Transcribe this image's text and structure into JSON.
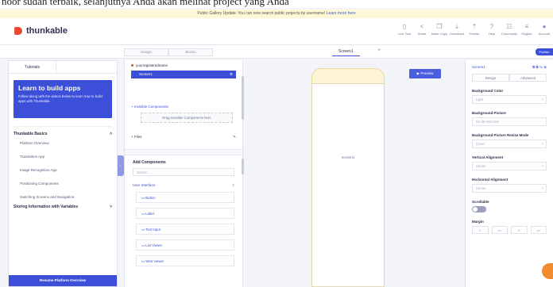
{
  "top_text": "noor sudah terbaik, selanjutnya Anda akan melihat project yang Anda",
  "banner": {
    "text": "Public Gallery Update: You can now search public projects by username!",
    "link": "Learn more here"
  },
  "app": {
    "name": "thunkable"
  },
  "toolbar": [
    "Live Test",
    "Share",
    "Make Copy",
    "Download",
    "Publish",
    "Help",
    "Community",
    "English",
    "Account"
  ],
  "editor_tabs": [
    "Design",
    "Blocks"
  ],
  "screen_tab": "Screen1",
  "publish_label": "Publish",
  "left_panel": {
    "tab": "Tutorials",
    "learn_title": "Learn to build apps",
    "learn_text": "Follow along with the videos below to learn how to build apps with Thunkable.",
    "section1": "Thunkable Basics",
    "items": [
      "Platform Overview",
      "Translation App",
      "Image Recognition App",
      "Positioning Components",
      "Switching Screens and Navigation"
    ],
    "section2": "Storing Information with Variables",
    "resume": "Resume Platform Overview"
  },
  "components": {
    "project": "yourregisteredname",
    "screen": "Screen1",
    "invisible": "+ Invisible Components",
    "drop_hint": "Drag Invisible Components here",
    "files": "+ Files",
    "add_title": "Add Components",
    "search": "Search",
    "group": "User Interface",
    "items": [
      "Button",
      "Label",
      "Text Input",
      "List Viewer",
      "Web Viewer"
    ]
  },
  "canvas": {
    "preview": "Preview",
    "phone_label": "Screen1"
  },
  "properties": {
    "title": "Screen1",
    "tabs": [
      "Design",
      "Advanced"
    ],
    "fields": [
      {
        "label": "Background Color",
        "value": "Light"
      },
      {
        "label": "Background Picture",
        "value": "No file selected"
      },
      {
        "label": "Background Picture Resize Mode",
        "value": "Cover"
      },
      {
        "label": "Vertical Alignment",
        "value": "Center"
      },
      {
        "label": "Horizontal Alignment",
        "value": "Center"
      }
    ],
    "scrollable": "Scrollable",
    "margin": "Margin",
    "margin_values": [
      "0",
      "px",
      "0",
      "px"
    ]
  }
}
